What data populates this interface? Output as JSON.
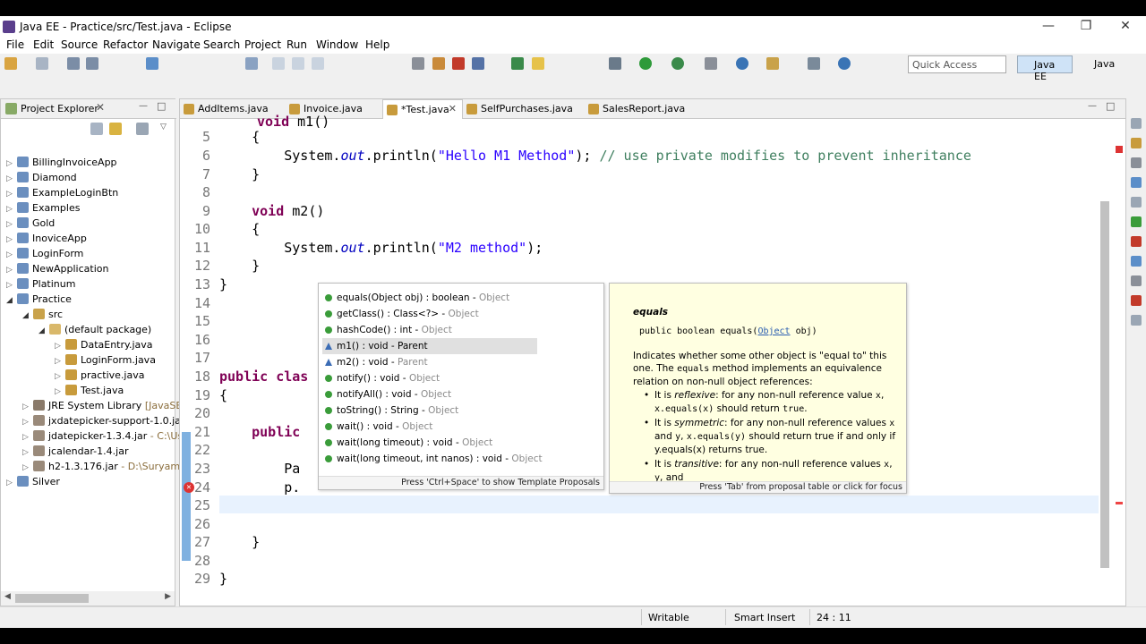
{
  "window": {
    "title": "Java EE - Practice/src/Test.java - Eclipse",
    "min": "—",
    "restore": "❐",
    "close": "✕"
  },
  "menu": [
    "File",
    "Edit",
    "Source",
    "Refactor",
    "Navigate",
    "Search",
    "Project",
    "Run",
    "Window",
    "Help"
  ],
  "toolbar": {
    "quick_access": "Quick Access",
    "perspective_active": "Java EE",
    "perspective_other": "Java"
  },
  "explorer": {
    "title": "Project Explorer",
    "items": [
      {
        "label": "BillingInvoiceApp",
        "extra": ""
      },
      {
        "label": "Diamond",
        "extra": ""
      },
      {
        "label": "ExampleLoginBtn",
        "extra": ""
      },
      {
        "label": "Examples",
        "extra": ""
      },
      {
        "label": "Gold",
        "extra": ""
      },
      {
        "label": "InoviceApp",
        "extra": ""
      },
      {
        "label": "LoginForm",
        "extra": ""
      },
      {
        "label": "NewApplication",
        "extra": ""
      },
      {
        "label": "Platinum",
        "extra": ""
      },
      {
        "label": "Practice",
        "extra": ""
      },
      {
        "label": "src",
        "extra": ""
      },
      {
        "label": "(default package)",
        "extra": ""
      },
      {
        "label": "DataEntry.java",
        "extra": ""
      },
      {
        "label": "LoginForm.java",
        "extra": ""
      },
      {
        "label": "practive.java",
        "extra": ""
      },
      {
        "label": "Test.java",
        "extra": ""
      },
      {
        "label": "JRE System Library",
        "extra": "[JavaSE-"
      },
      {
        "label": "jxdatepicker-support-1.0.ja",
        "extra": ""
      },
      {
        "label": "jdatepicker-1.3.4.jar",
        "extra": "- C:\\Us"
      },
      {
        "label": "jcalendar-1.4.jar",
        "extra": ""
      },
      {
        "label": "h2-1.3.176.jar",
        "extra": "- D:\\Suryam\\"
      },
      {
        "label": "Silver",
        "extra": ""
      }
    ]
  },
  "editor": {
    "tabs": [
      "AddItems.java",
      "Invoice.java",
      "*Test.java",
      "SelfPurchases.java",
      "SalesReport.java"
    ],
    "lines": [
      {
        "n": "5",
        "t": "    {"
      },
      {
        "n": "6",
        "t": "        System.out.println(\"Hello M1 Method\"); // use private modifies to prevent inheritance"
      },
      {
        "n": "7",
        "t": "    }"
      },
      {
        "n": "8",
        "t": ""
      },
      {
        "n": "9",
        "t": "    void m2()"
      },
      {
        "n": "10",
        "t": "    {"
      },
      {
        "n": "11",
        "t": "        System.out.println(\"M2 method\");"
      },
      {
        "n": "12",
        "t": "    }"
      },
      {
        "n": "13",
        "t": "}"
      },
      {
        "n": "14",
        "t": ""
      },
      {
        "n": "15",
        "t": ""
      },
      {
        "n": "16",
        "t": ""
      },
      {
        "n": "17",
        "t": ""
      },
      {
        "n": "18",
        "t": "public clas"
      },
      {
        "n": "19",
        "t": "{"
      },
      {
        "n": "20",
        "t": ""
      },
      {
        "n": "21",
        "t": "    public"
      },
      {
        "n": "22",
        "t": ""
      },
      {
        "n": "23",
        "t": "        Pa"
      },
      {
        "n": "24",
        "t": "        p."
      },
      {
        "n": "25",
        "t": ""
      },
      {
        "n": "26",
        "t": ""
      },
      {
        "n": "27",
        "t": "    }"
      },
      {
        "n": "28",
        "t": ""
      },
      {
        "n": "29",
        "t": "}"
      }
    ]
  },
  "assist": {
    "proposals": [
      {
        "sig": "equals(Object obj) : boolean",
        "owner": "Object",
        "icon": "public-method-icon"
      },
      {
        "sig": "getClass() : Class<?>",
        "owner": "Object",
        "icon": "public-method-icon"
      },
      {
        "sig": "hashCode() : int",
        "owner": "Object",
        "icon": "public-method-icon"
      },
      {
        "sig": "m1() : void",
        "owner": "Parent",
        "icon": "default-method-icon"
      },
      {
        "sig": "m2() : void",
        "owner": "Parent",
        "icon": "default-method-icon"
      },
      {
        "sig": "notify() : void",
        "owner": "Object",
        "icon": "public-method-icon"
      },
      {
        "sig": "notifyAll() : void",
        "owner": "Object",
        "icon": "public-method-icon"
      },
      {
        "sig": "toString() : String",
        "owner": "Object",
        "icon": "public-method-icon"
      },
      {
        "sig": "wait() : void",
        "owner": "Object",
        "icon": "public-method-icon"
      },
      {
        "sig": "wait(long timeout) : void",
        "owner": "Object",
        "icon": "public-method-icon"
      },
      {
        "sig": "wait(long timeout, int nanos) : void",
        "owner": "Object",
        "icon": "public-method-icon"
      }
    ],
    "selected_index": 3,
    "footer": "Press 'Ctrl+Space' to show Template Proposals"
  },
  "javadoc": {
    "name": "equals",
    "sig_prefix": "public boolean equals(",
    "sig_type": "Object",
    "sig_suffix": " obj)",
    "para_a": "Indicates whether some other object is \"equal to\" this one. The ",
    "para_code": "equals",
    "para_b": " method implements an equivalence relation on non-null object references:",
    "bullets": [
      {
        "a": "It is ",
        "em": "reflexive",
        "b": ": for any non-null reference value ",
        "c": "x",
        "d": ", ",
        "e": "x.equals(x)",
        "f": " should return ",
        "g": "true",
        "h": "."
      },
      {
        "a": "It is ",
        "em": "symmetric",
        "b": ": for any non-null reference values ",
        "c": "x",
        "d": " and ",
        "e": "y",
        "f": ", ",
        "g": "x.equals(y)",
        "h": " should return true if and only if y.equals(x) returns true."
      },
      {
        "a": "It is ",
        "em": "transitive",
        "b": ": for any non-null reference values ",
        "c": "x",
        "d": ", ",
        "e": "y",
        "f": ", and",
        "g": "",
        "h": ""
      }
    ],
    "footer": "Press 'Tab' from proposal table or click for focus"
  },
  "status": {
    "writable": "Writable",
    "insert_mode": "Smart Insert",
    "position": "24 : 11"
  },
  "colors": {
    "selection": "#e0e0e0",
    "doc_bg": "#ffffe1",
    "keyword": "#7f0055",
    "string": "#2a00ff",
    "comment": "#3f7f5f"
  }
}
